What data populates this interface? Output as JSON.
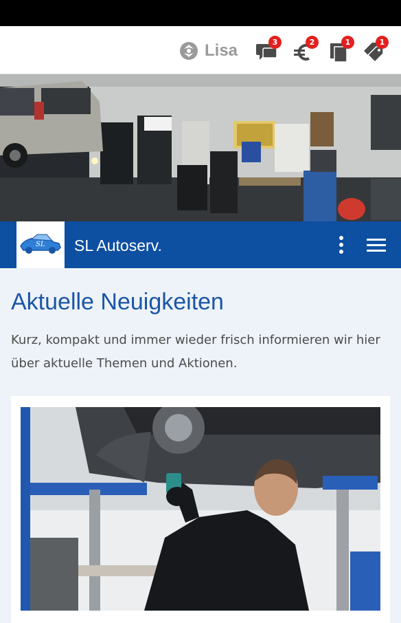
{
  "topbar": {
    "user_name": "Lisa",
    "icons": [
      {
        "name": "chat-icon",
        "badge": "3"
      },
      {
        "name": "euro-icon",
        "badge": "2"
      },
      {
        "name": "documents-icon",
        "badge": "1"
      },
      {
        "name": "tag-icon",
        "badge": "1"
      }
    ]
  },
  "navbar": {
    "brand": "SL Autoserv.",
    "logo_text": "SL"
  },
  "main": {
    "title": "Aktuelle Neuigkeiten",
    "intro": "Kurz, kompakt und immer wieder frisch informieren wir hier über aktuelle Themen und Aktionen."
  },
  "colors": {
    "primary": "#0d4fa1",
    "badge": "#e4201f",
    "title": "#1a56a6"
  }
}
